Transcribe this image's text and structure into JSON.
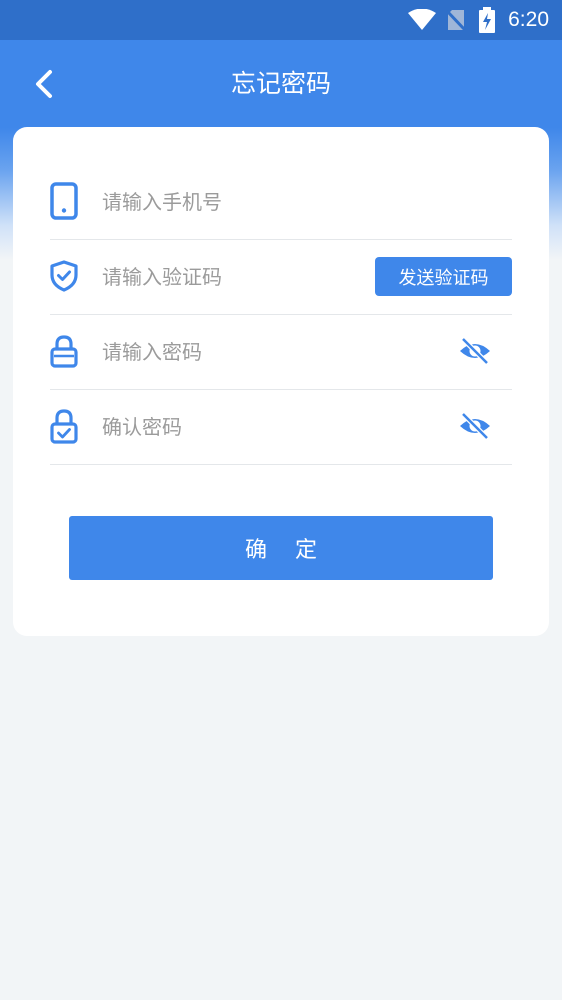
{
  "status_bar": {
    "time": "6:20",
    "icons": [
      "wifi-icon",
      "no-sim-icon",
      "battery-charging-icon"
    ]
  },
  "header": {
    "title": "忘记密码",
    "back_icon": "chevron-left-icon"
  },
  "form": {
    "phone": {
      "placeholder": "请输入手机号",
      "icon": "phone-icon"
    },
    "code": {
      "placeholder": "请输入验证码",
      "icon": "shield-check-icon",
      "send_label": "发送验证码"
    },
    "password": {
      "placeholder": "请输入密码",
      "icon": "lock-icon",
      "toggle_icon": "eye-off-icon"
    },
    "confirm_password": {
      "placeholder": "确认密码",
      "icon": "lock-check-icon",
      "toggle_icon": "eye-off-icon"
    },
    "submit_label": "确    定"
  },
  "colors": {
    "accent": "#3f87ea",
    "status_bar": "#2f6fc9",
    "background": "#f2f5f7"
  }
}
